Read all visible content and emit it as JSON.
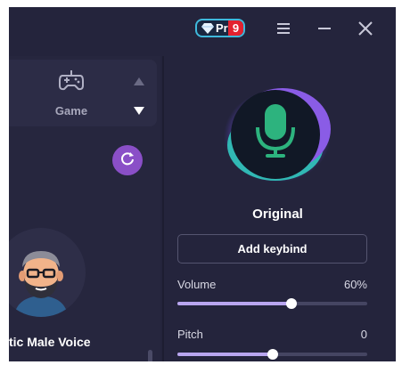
{
  "titlebar": {
    "pro_label": "Pro",
    "pro_count": "9",
    "icons": [
      "diamond-icon",
      "menu-icon",
      "minimize-icon",
      "close-icon"
    ]
  },
  "category": {
    "label": "Game",
    "icon": "gamepad-icon"
  },
  "voice_list": {
    "visible_item_name": "tic Male Voice"
  },
  "current": {
    "voice_name": "Original",
    "keybind_label": "Add keybind"
  },
  "sliders": {
    "volume": {
      "label": "Volume",
      "value": "60%",
      "level": 0.6
    },
    "pitch": {
      "label": "Pitch",
      "value": "0",
      "level": 0.5
    }
  },
  "colors": {
    "background": "#24243c",
    "accent_purple": "#8a4fc7",
    "mic_green": "#2db37e",
    "pro_border": "#3fb9dc",
    "badge_red": "#e2222f"
  }
}
